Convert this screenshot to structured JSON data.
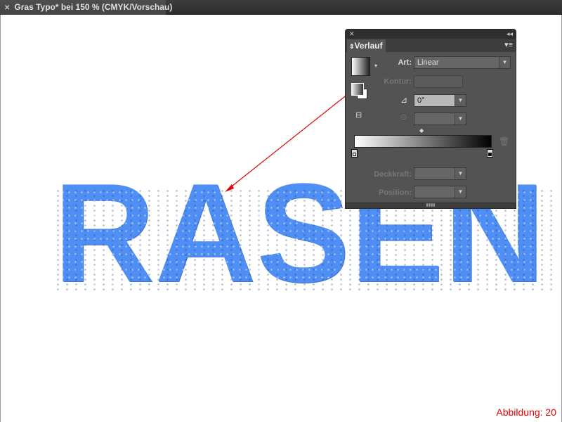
{
  "document": {
    "tab_title": "Gras Typo* bei 150 % (CMYK/Vorschau)",
    "close_icon": "close-icon"
  },
  "canvas": {
    "artwork_text": "RASEN",
    "text_color": "#4f8ef5",
    "caption": "Abbildung: 20",
    "arrow_color": "#e00000"
  },
  "panel": {
    "title": "Verlauf",
    "art_label": "Art:",
    "art_value": "Linear",
    "kontur_label": "Kontur:",
    "angle_value": "0°",
    "deckkraft_label": "Deckkraft:",
    "position_label": "Position:",
    "gradient": {
      "start_color": "#ffffff",
      "end_color": "#000000"
    }
  }
}
